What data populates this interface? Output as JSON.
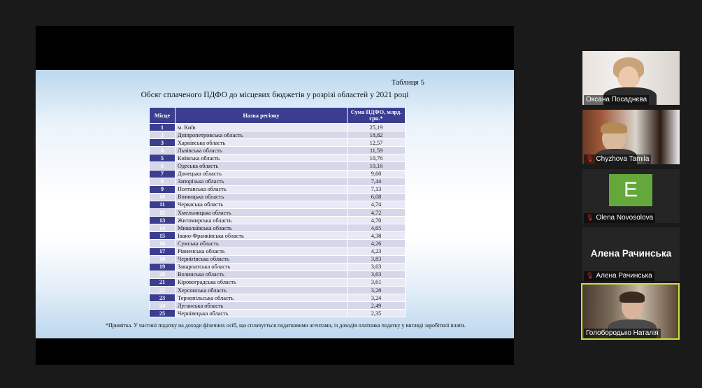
{
  "slide": {
    "table_number": "Таблиця 5",
    "title": "Обсяг сплаченого ПДФО до місцевих бюджетів у розрізі областей у 2021 році",
    "headers": {
      "rank": "Місце",
      "region": "Назва регіону",
      "sum": "Сума ПДФО, млрд. грн.*"
    },
    "rows": [
      {
        "rank": "1",
        "region": "м. Київ",
        "value": "25,19"
      },
      {
        "rank": "2",
        "region": "Дніпропетровська область",
        "value": "18,82"
      },
      {
        "rank": "3",
        "region": "Харківська область",
        "value": "12,57"
      },
      {
        "rank": "4",
        "region": "Львівська область",
        "value": "11,59"
      },
      {
        "rank": "5",
        "region": "Київська область",
        "value": "10,76"
      },
      {
        "rank": "6",
        "region": "Одеська область",
        "value": "10,16"
      },
      {
        "rank": "7",
        "region": "Донецька область",
        "value": "9,60"
      },
      {
        "rank": "8",
        "region": "Запорізька область",
        "value": "7,44"
      },
      {
        "rank": "9",
        "region": "Полтавська область",
        "value": "7,13"
      },
      {
        "rank": "10",
        "region": "Вінницька область",
        "value": "6,08"
      },
      {
        "rank": "11",
        "region": "Черкаська область",
        "value": "4,74"
      },
      {
        "rank": "12",
        "region": "Хмельницька область",
        "value": "4,72"
      },
      {
        "rank": "13",
        "region": "Житомирська область",
        "value": "4,70"
      },
      {
        "rank": "14",
        "region": "Миколаївська область",
        "value": "4,65"
      },
      {
        "rank": "15",
        "region": "Івано-Франківська область",
        "value": "4,38"
      },
      {
        "rank": "16",
        "region": "Сумська область",
        "value": "4,26"
      },
      {
        "rank": "17",
        "region": "Рівненська область",
        "value": "4,23"
      },
      {
        "rank": "18",
        "region": "Чернігівська область",
        "value": "3,83"
      },
      {
        "rank": "19",
        "region": "Закарпатська область",
        "value": "3,63"
      },
      {
        "rank": "20",
        "region": "Волинська область",
        "value": "3,63"
      },
      {
        "rank": "21",
        "region": "Кіровоградська область",
        "value": "3,61"
      },
      {
        "rank": "22",
        "region": "Херсонська область",
        "value": "3,28"
      },
      {
        "rank": "23",
        "region": "Тернопільська область",
        "value": "3,24"
      },
      {
        "rank": "24",
        "region": "Луганська область",
        "value": "2,49"
      },
      {
        "rank": "25",
        "region": "Чернівецька область",
        "value": "2,35"
      }
    ],
    "note": "*Примітка. У частині податку на доходи фізичних осіб, що сплачується податковими агентами, із доходів платника податку у вигляді заробітної плати."
  },
  "participants": [
    {
      "name": "Оксана Посаднєва",
      "muted": false
    },
    {
      "name": "Chyzhova Tamila",
      "muted": true
    },
    {
      "name": "Olena Novosolova",
      "muted": true,
      "avatar_letter": "E"
    },
    {
      "name": "Алена Рачинська",
      "muted": true,
      "display_name": "Алена Рачинська"
    },
    {
      "name": "Голобородько Наталія",
      "muted": false,
      "active_speaker": true
    }
  ],
  "colors": {
    "table_header": "#3b3d8f",
    "avatar_green": "#64a83b",
    "active_border": "#c8e23a",
    "mute_red": "#e02b2b"
  },
  "icons": {
    "muted": "muted-microphone-icon"
  }
}
